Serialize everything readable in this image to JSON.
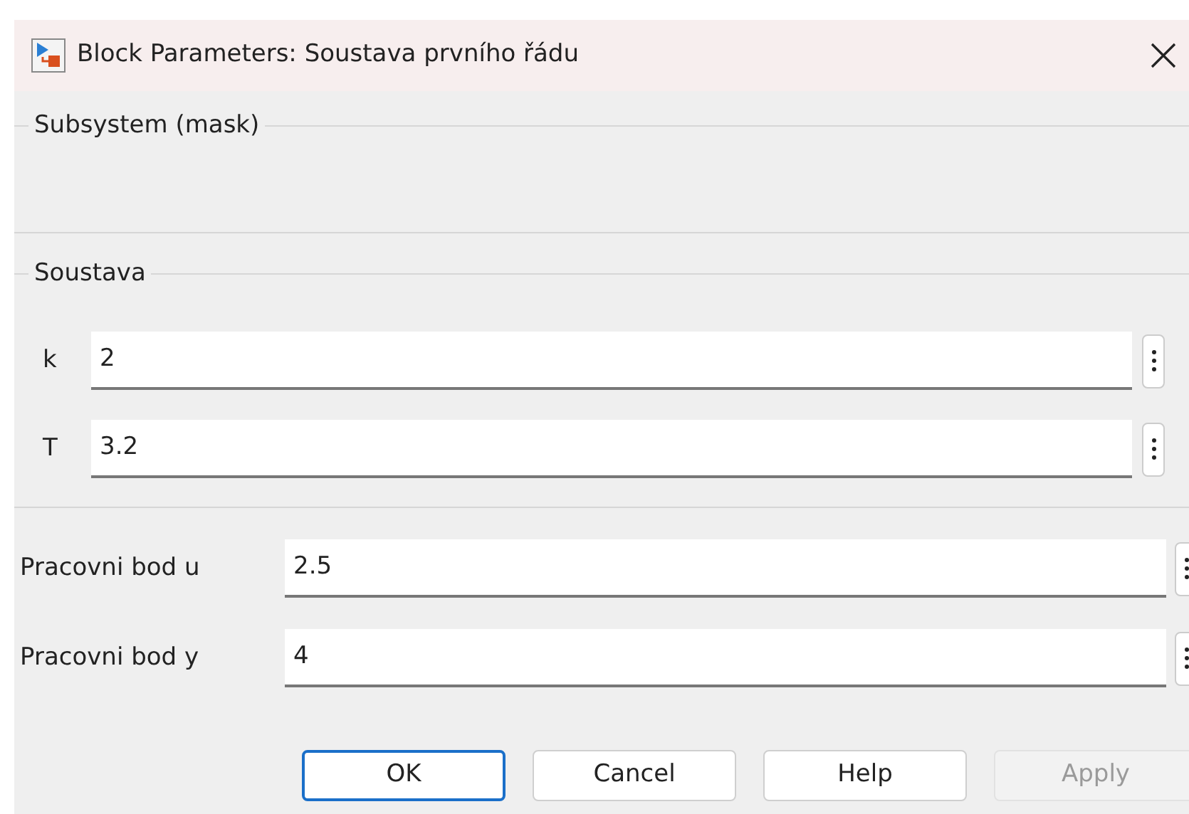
{
  "window": {
    "title": "Block Parameters: Soustava prvního řádu"
  },
  "groups": [
    {
      "title": "Subsystem (mask)"
    },
    {
      "title": "Soustava",
      "params": [
        {
          "label": "k",
          "value": "2"
        },
        {
          "label": "T",
          "value": "3.2"
        }
      ]
    }
  ],
  "params": [
    {
      "label": "Pracovni bod u",
      "value": "2.5"
    },
    {
      "label": "Pracovni bod y",
      "value": "4"
    }
  ],
  "buttons": [
    {
      "label": "OK",
      "focused": true,
      "disabled": false
    },
    {
      "label": "Cancel",
      "focused": false,
      "disabled": false
    },
    {
      "label": "Help",
      "focused": false,
      "disabled": false
    },
    {
      "label": "Apply",
      "focused": false,
      "disabled": true
    }
  ]
}
